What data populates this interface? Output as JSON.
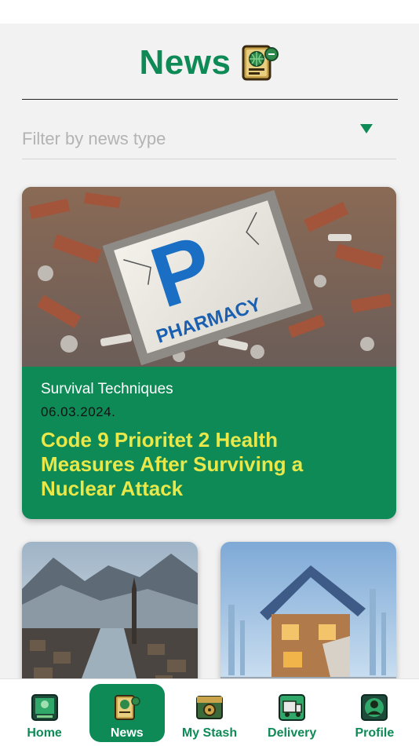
{
  "header": {
    "title": "News",
    "icon": "news-app-icon"
  },
  "filter": {
    "placeholder": "Filter by news type",
    "icon": "dropdown-caret-icon"
  },
  "featured": {
    "category": "Survival Techniques",
    "date": "06.03.2024.",
    "headline": "Code 9 Prioritet 2 Health Measures After Surviving a Nuclear Attack",
    "image_text": {
      "letter": "P",
      "word": "PHARMACY"
    }
  },
  "cards": [
    {
      "image": "flooded-valley-village-image"
    },
    {
      "image": "damaged-house-image"
    }
  ],
  "nav": {
    "items": [
      {
        "label": "Home",
        "icon": "home-icon",
        "active": false
      },
      {
        "label": "News",
        "icon": "news-icon",
        "active": true
      },
      {
        "label": "My Stash",
        "icon": "stash-icon",
        "active": false
      },
      {
        "label": "Delivery",
        "icon": "delivery-truck-icon",
        "active": false
      },
      {
        "label": "Profile",
        "icon": "profile-icon",
        "active": false
      }
    ]
  },
  "colors": {
    "brand_green": "#0e8a57",
    "headline_yellow": "#e9e84a",
    "background": "#f2f2f2"
  }
}
